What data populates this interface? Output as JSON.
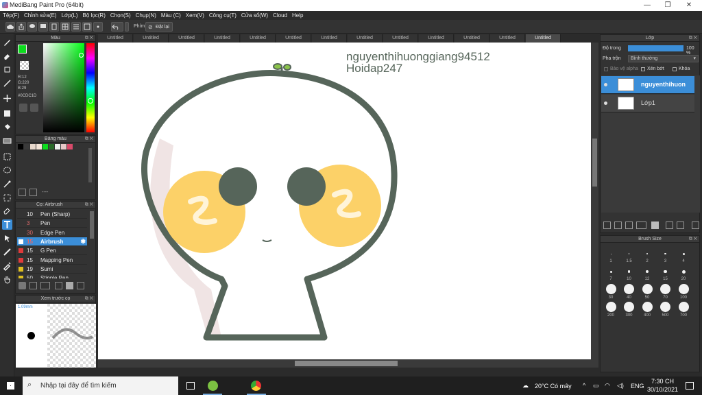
{
  "window": {
    "title": "MediBang Paint Pro (64bit)"
  },
  "menu": [
    "Tệp(F)",
    "Chỉnh sửa(E)",
    "Lớp(L)",
    "Bộ lọc(R)",
    "Chọn(S)",
    "Chụp(N)",
    "Màu (C)",
    "Xem(V)",
    "Công cụ(T)",
    "Cửa sổ(W)",
    "Cloud",
    "Help"
  ],
  "toolbar": {
    "shortcut_label": "Phím",
    "reset_label": "Đặt lại"
  },
  "tabs": [
    "Untitled",
    "Untitled",
    "Untitled",
    "Untitled",
    "Untitled",
    "Untitled",
    "Untitled",
    "Untitled",
    "Untitled",
    "Untitled",
    "Untitled",
    "Untitled",
    "Untitled"
  ],
  "color_panel": {
    "title": "Màu",
    "r": "R:12",
    "g": "G:220",
    "b": "B:29",
    "hex": "#0CDC1D",
    "fg_color": "#0CDC1D"
  },
  "palette_panel": {
    "title": "Bảng màu",
    "colors": [
      "#000000",
      "#3a3a3a",
      "#e8d8cc",
      "#f4e4d8",
      "#0cdc1d",
      "#2a6a2a",
      "#f0f0f0",
      "#e8c8c8",
      "#d84a6a"
    ],
    "empty_label": "----"
  },
  "brush_panel": {
    "title": "Cọ: Airbrush",
    "items": [
      {
        "size": "10",
        "name": "Pen (Sharp)",
        "color": "#333333"
      },
      {
        "size": "3",
        "name": "Pen",
        "color": "#333333"
      },
      {
        "size": "30",
        "name": "Edge Pen",
        "color": "#333333"
      },
      {
        "size": "15",
        "name": "Airbrush",
        "color": "#ffffff"
      },
      {
        "size": "15",
        "name": "G Pen",
        "color": "#e03a3a"
      },
      {
        "size": "15",
        "name": "Mapping Pen",
        "color": "#e03a3a"
      },
      {
        "size": "19",
        "name": "Sumi",
        "color": "#e0c020"
      },
      {
        "size": "50",
        "name": "Stipple Pen",
        "color": "#e0c020"
      }
    ]
  },
  "preview_panel": {
    "title": "Xem trước cọ",
    "size": "1.09mm"
  },
  "canvas": {
    "text_line1": "nguyenthihuonggiang94512",
    "text_line2": "Hoidap247",
    "outline_color": "#56655a",
    "cheek_color": "#fcd168",
    "eye_color": "#56655a"
  },
  "layer_panel": {
    "title": "Lớp",
    "opacity_label": "Độ trong",
    "opacity_value": "100 %",
    "blend_label": "Pha trộn",
    "blend_value": "Bình thường",
    "protect_alpha": "Bảo vệ alpha",
    "clip": "Xén bớt",
    "lock": "Khóa",
    "layers": [
      {
        "name": "nguyenthihuon",
        "selected": true
      },
      {
        "name": "Lớp1",
        "selected": false
      }
    ]
  },
  "brush_size_panel": {
    "title": "Brush Size",
    "sizes": [
      "1",
      "1.5",
      "2",
      "3",
      "4",
      "7",
      "10",
      "12",
      "15",
      "20",
      "30",
      "40",
      "50",
      "70",
      "100",
      "200",
      "300",
      "400",
      "500",
      "700"
    ]
  },
  "taskbar": {
    "search_placeholder": "Nhập tại đây để tìm kiếm",
    "weather": "20°C  Có mây",
    "lang": "ENG",
    "time": "7:30 CH",
    "date": "30/10/2021"
  }
}
